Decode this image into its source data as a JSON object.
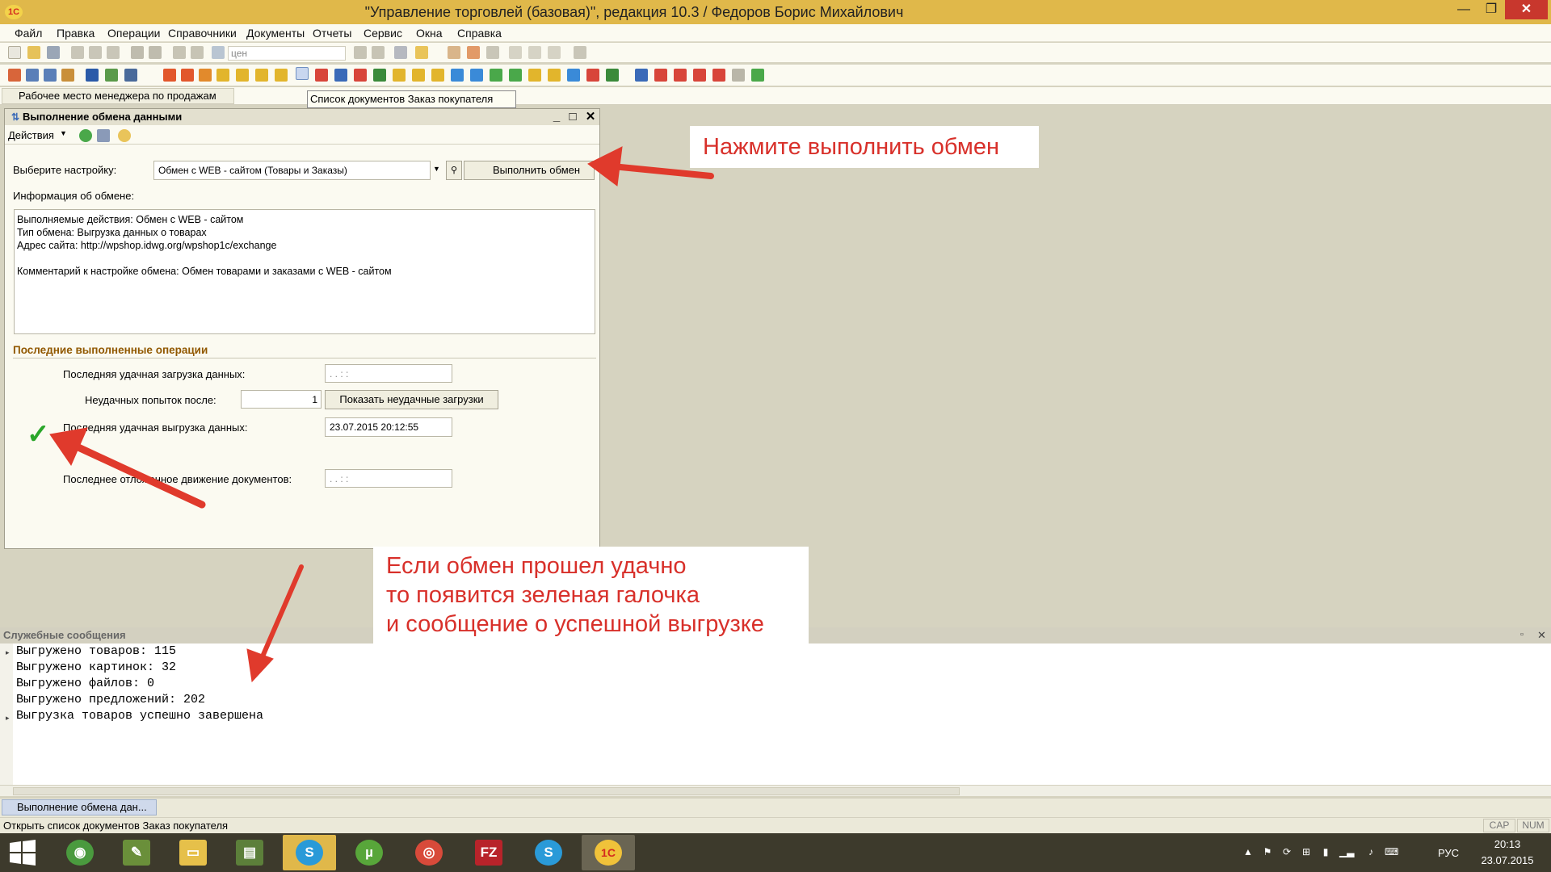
{
  "window": {
    "title": "\"Управление торговлей (базовая)\", редакция 10.3 / Федоров Борис Михайлович",
    "logo": "1С"
  },
  "menu": [
    "Файл",
    "Правка",
    "Операции",
    "Справочники",
    "Документы",
    "Отчеты",
    "Сервис",
    "Окна",
    "Справка"
  ],
  "toolbar": {
    "search_value": "цен"
  },
  "top_tab": {
    "label": "Рабочее место менеджера по продажам"
  },
  "tooltip": "Список документов Заказ покупателя",
  "dialog": {
    "title": "Выполнение обмена данными",
    "actions_label": "Действия",
    "setting_label": "Выберите настройку:",
    "setting_value": "Обмен с WEB - сайтом (Товары и Заказы)",
    "run_button": "Выполнить обмен",
    "info_label": "Информация об обмене:",
    "info_lines": [
      "Выполняемые действия: Обмен с WEB - сайтом",
      "Тип обмена:  Выгрузка данных о товарах",
      "Адрес сайта: http://wpshop.idwg.org/wpshop1c/exchange",
      "",
      "Комментарий к настройке обмена: Обмен товарами и заказами с WEB - сайтом"
    ],
    "section_title": "Последние выполненные операции",
    "last_load_label": "Последняя удачная загрузка данных:",
    "last_load_value": ". .     : :",
    "failed_attempts_label": "Неудачных попыток после:",
    "failed_attempts_value": "1",
    "show_failed_button": "Показать неудачные загрузки",
    "last_unload_label": "Последняя удачная выгрузка данных:",
    "last_unload_value": "23.07.2015 20:12:55",
    "last_movement_label": "Последнее отложенное движение документов:",
    "last_movement_value": ". .     : :"
  },
  "messages": {
    "header": "Служебные сообщения",
    "lines": [
      "Выгружено товаров: 115",
      "Выгружено картинок: 32",
      "Выгружено файлов: 0",
      "Выгружено предложений: 202",
      "Выгрузка товаров успешно завершена"
    ]
  },
  "window_tab": "Выполнение обмена дан...",
  "status": {
    "text": "Открыть список документов Заказ покупателя",
    "cap": "CAP",
    "num": "NUM"
  },
  "taskbar": {
    "language": "РУС",
    "time": "20:13",
    "date": "23.07.2015",
    "apps": [
      {
        "icon": "chrome-browser-icon",
        "color": "#4a9a3e"
      },
      {
        "icon": "notepad-icon",
        "color": "#6a8f3a"
      },
      {
        "icon": "folder-icon",
        "color": "#e6c04a"
      },
      {
        "icon": "task-manager-icon",
        "color": "#5c7f3a"
      },
      {
        "icon": "skype-icon",
        "color": "#2a9ad8"
      },
      {
        "icon": "utorrent-icon",
        "color": "#58a63a"
      },
      {
        "icon": "chrome-icon",
        "color": "#d84a3a"
      },
      {
        "icon": "filezilla-icon",
        "color": "#b8232a"
      },
      {
        "icon": "skype-icon",
        "color": "#2a9ad8"
      },
      {
        "icon": "1c-icon",
        "color": "#f0c23a"
      }
    ]
  },
  "callouts": {
    "top": "Нажмите выполнить обмен",
    "bottom": [
      "Если обмен прошел удачно",
      "то появится зеленая галочка",
      "и сообщение о успешной выгрузке"
    ]
  },
  "colors": {
    "callout_text": "#d8302a",
    "arrow": "#e03a2c",
    "checkmark": "#2aa62a",
    "section_title": "#915800"
  }
}
